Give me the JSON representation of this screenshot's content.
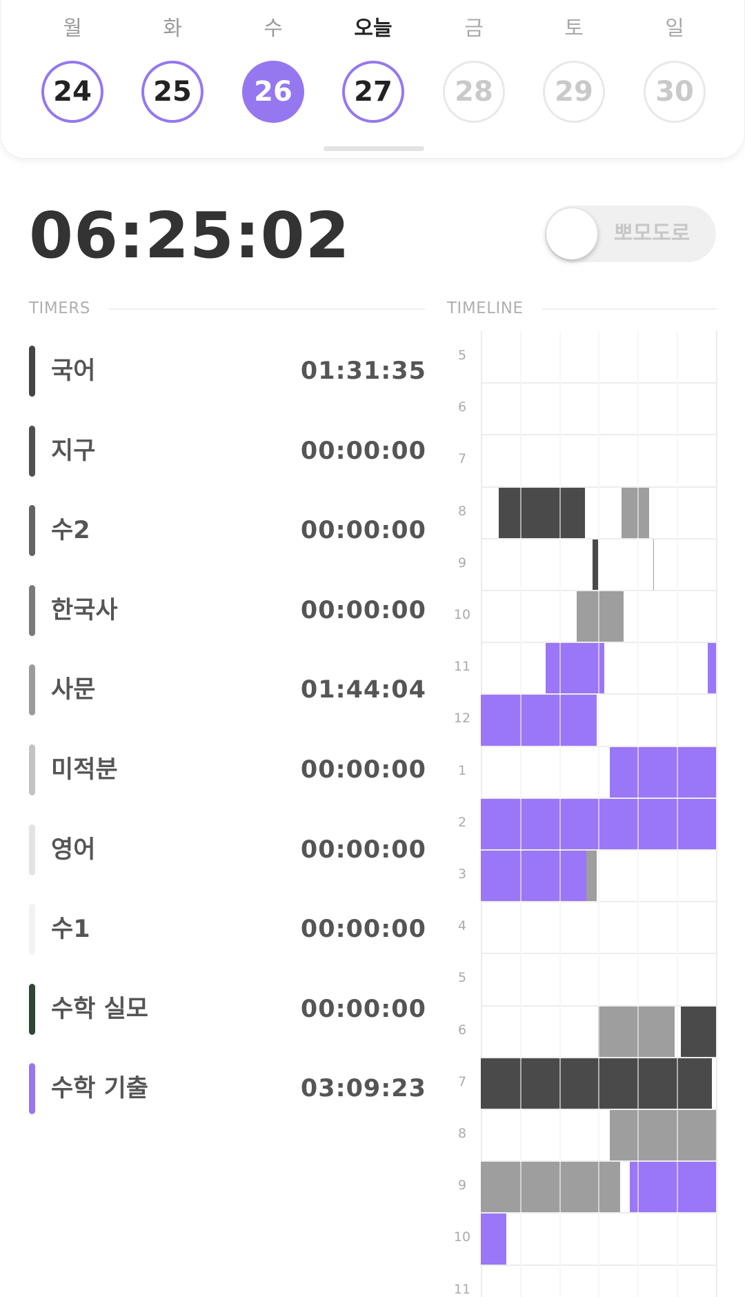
{
  "week": {
    "days": [
      {
        "name": "월",
        "date": "24",
        "state": "past"
      },
      {
        "name": "화",
        "date": "25",
        "state": "past"
      },
      {
        "name": "수",
        "date": "26",
        "state": "selected"
      },
      {
        "name": "오늘",
        "date": "27",
        "state": "today"
      },
      {
        "name": "금",
        "date": "28",
        "state": "future"
      },
      {
        "name": "토",
        "date": "29",
        "state": "future"
      },
      {
        "name": "일",
        "date": "30",
        "state": "future"
      }
    ]
  },
  "clock": "06:25:02",
  "pomodoro": {
    "label": "뽀모도로",
    "on": false
  },
  "sections": {
    "timers": "TIMERS",
    "timeline": "TIMELINE"
  },
  "timers": [
    {
      "name": "국어",
      "time": "01:31:35",
      "color": "#444444"
    },
    {
      "name": "지구",
      "time": "00:00:00",
      "color": "#505050"
    },
    {
      "name": "수2",
      "time": "00:00:00",
      "color": "#636363"
    },
    {
      "name": "한국사",
      "time": "00:00:00",
      "color": "#7a7a7a"
    },
    {
      "name": "사문",
      "time": "01:44:04",
      "color": "#9b9b9b"
    },
    {
      "name": "미적분",
      "time": "00:00:00",
      "color": "#c3c3c3"
    },
    {
      "name": "영어",
      "time": "00:00:00",
      "color": "#e3e3e3"
    },
    {
      "name": "수1",
      "time": "00:00:00",
      "color": "#f2f2f2"
    },
    {
      "name": "수학 실모",
      "time": "00:00:00",
      "color": "#2d4733"
    },
    {
      "name": "수학 기출",
      "time": "03:09:23",
      "color": "#9577f0"
    }
  ],
  "timeline": {
    "hours": [
      "5",
      "6",
      "7",
      "8",
      "9",
      "10",
      "11",
      "12",
      "1",
      "2",
      "3",
      "4",
      "5",
      "6",
      "7",
      "8",
      "9",
      "10",
      "11"
    ],
    "colors": {
      "dark": "#4a4a4a",
      "gray": "#9e9e9e",
      "purple": "#9a77f7"
    },
    "segments": [
      {
        "hour": 3,
        "start": 0.45,
        "end": 2.65,
        "color": "dark"
      },
      {
        "hour": 3,
        "start": 3.6,
        "end": 4.3,
        "color": "gray"
      },
      {
        "hour": 4,
        "start": 2.85,
        "end": 3.0,
        "color": "dark"
      },
      {
        "hour": 4,
        "start": 4.4,
        "end": 4.42,
        "color": "gray"
      },
      {
        "hour": 5,
        "start": 2.45,
        "end": 3.65,
        "color": "gray"
      },
      {
        "hour": 6,
        "start": 1.65,
        "end": 3.15,
        "color": "purple"
      },
      {
        "hour": 6,
        "start": 5.8,
        "end": 6.0,
        "color": "purple"
      },
      {
        "hour": 7,
        "start": 0.0,
        "end": 2.95,
        "color": "purple"
      },
      {
        "hour": 8,
        "start": 3.3,
        "end": 6.0,
        "color": "purple"
      },
      {
        "hour": 9,
        "start": 0.0,
        "end": 6.0,
        "color": "purple"
      },
      {
        "hour": 10,
        "start": 0.0,
        "end": 2.7,
        "color": "purple"
      },
      {
        "hour": 10,
        "start": 2.7,
        "end": 2.95,
        "color": "gray"
      },
      {
        "hour": 13,
        "start": 3.0,
        "end": 4.95,
        "color": "gray"
      },
      {
        "hour": 13,
        "start": 5.1,
        "end": 6.0,
        "color": "dark"
      },
      {
        "hour": 14,
        "start": 0.0,
        "end": 5.9,
        "color": "dark"
      },
      {
        "hour": 15,
        "start": 3.3,
        "end": 6.0,
        "color": "gray"
      },
      {
        "hour": 16,
        "start": 0.0,
        "end": 3.55,
        "color": "gray"
      },
      {
        "hour": 16,
        "start": 3.8,
        "end": 6.0,
        "color": "purple"
      },
      {
        "hour": 17,
        "start": 0.0,
        "end": 0.65,
        "color": "purple"
      }
    ]
  }
}
